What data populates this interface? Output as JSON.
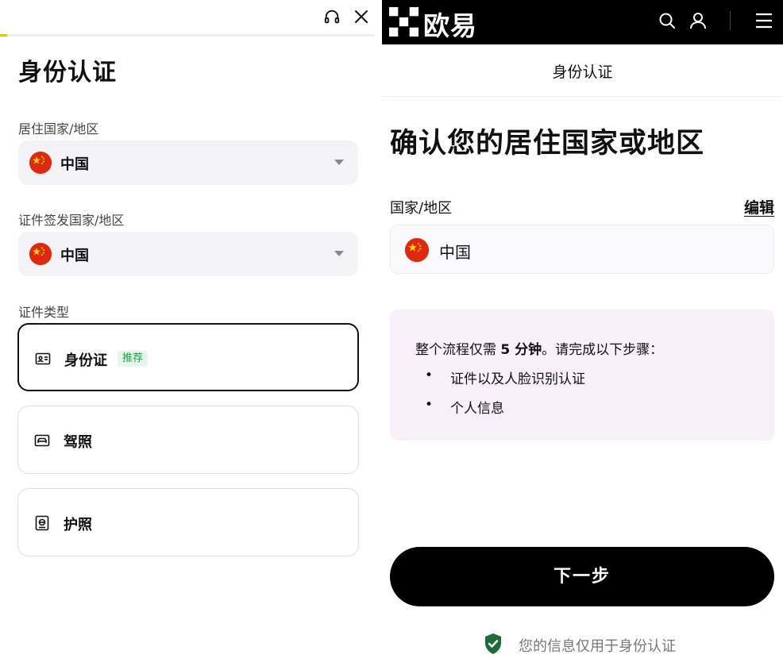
{
  "left": {
    "title": "身份认证",
    "progress": 0.02,
    "icons": {
      "support": "headset-icon",
      "close": "close-icon"
    },
    "residence": {
      "label": "居住国家/地区",
      "value": "中国",
      "flag": "china-flag-icon"
    },
    "issuing": {
      "label": "证件签发国家/地区",
      "value": "中国",
      "flag": "china-flag-icon"
    },
    "doc_type_label": "证件类型",
    "doc_options": [
      {
        "label": "身份证",
        "badge": "推荐",
        "icon": "id-card-icon",
        "selected": true
      },
      {
        "label": "驾照",
        "icon": "driver-license-icon",
        "selected": false
      },
      {
        "label": "护照",
        "icon": "passport-icon",
        "selected": false
      }
    ],
    "accent_color": "#f2c100"
  },
  "right": {
    "brand": "欧易",
    "nav_icons": [
      "search-icon",
      "user-icon",
      "menu-icon"
    ],
    "header_title": "身份认证",
    "confirm_title": "确认您的居住国家或地区",
    "country_label": "国家/地区",
    "edit_label": "编辑",
    "country_value": "中国",
    "info": {
      "intro_prefix": "整个流程仅需 ",
      "intro_bold": "5 分钟",
      "intro_suffix": "。请完成以下步骤：",
      "bullet": "•",
      "steps": [
        "证件以及人脸识别认证",
        "个人信息"
      ]
    },
    "next_button": "下一步",
    "privacy_text": "您的信息仅用于身份认证",
    "shield_color": "#1f6b3a",
    "info_bg": "#f7f0f8"
  }
}
